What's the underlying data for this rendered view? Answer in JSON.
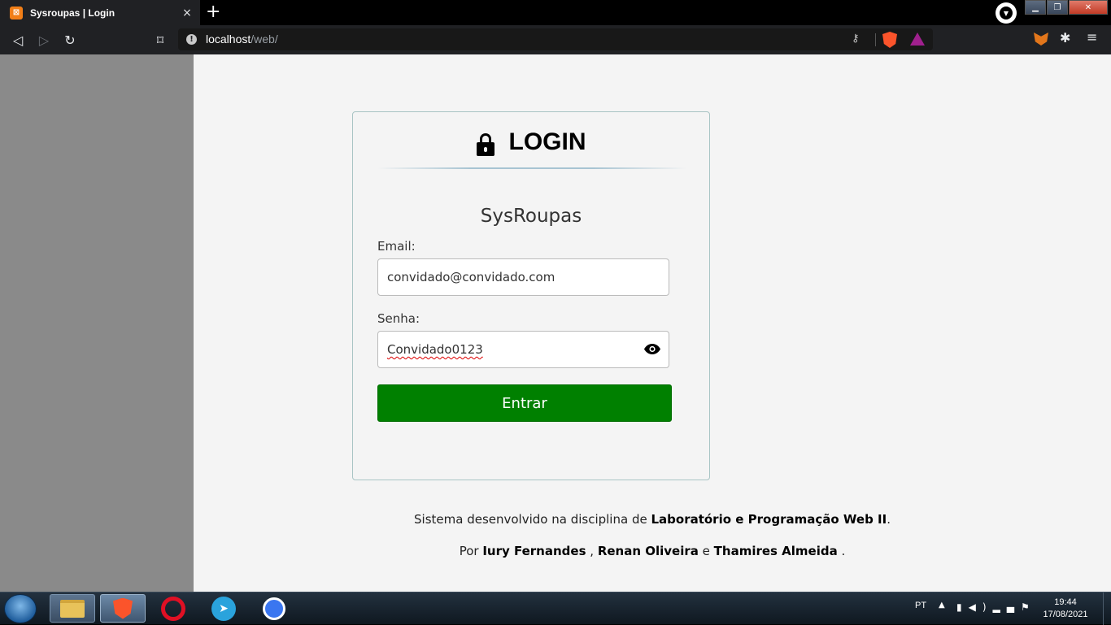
{
  "browser": {
    "tab_title": "Sysroupas | Login",
    "tab_close": "×",
    "new_tab": "+",
    "url_host": "localhost",
    "url_path": "/web/"
  },
  "login": {
    "title": "LOGIN",
    "app_name": "SysRoupas",
    "email_label": "Email:",
    "email_value": "convidado@convidado.com",
    "password_label": "Senha:",
    "password_value": "Convidado0123",
    "submit_label": "Entrar"
  },
  "footer": {
    "line1_prefix": "Sistema desenvolvido na disciplina de ",
    "line1_course": "Laboratório e Programação Web II",
    "line1_suffix": ".",
    "line2_prefix": "Por ",
    "author1": "Iury Fernandes",
    "sep1": " , ",
    "author2": "Renan Oliveira",
    "sep2": " e ",
    "author3": "Thamires Almeida",
    "line2_suffix": " ."
  },
  "taskbar": {
    "language": "PT",
    "time": "19:44",
    "date": "17/08/2021"
  },
  "colors": {
    "submit_button": "#008000",
    "sidebar": "#8a8a8a",
    "content_bg": "#f4f4f4"
  },
  "icons": [
    "lock-icon",
    "eye-icon",
    "back-icon",
    "forward-icon",
    "reload-icon",
    "bookmark-icon",
    "key-icon",
    "brave-shields-icon",
    "brave-rewards-icon",
    "metamask-icon",
    "extensions-icon",
    "menu-icon"
  ]
}
